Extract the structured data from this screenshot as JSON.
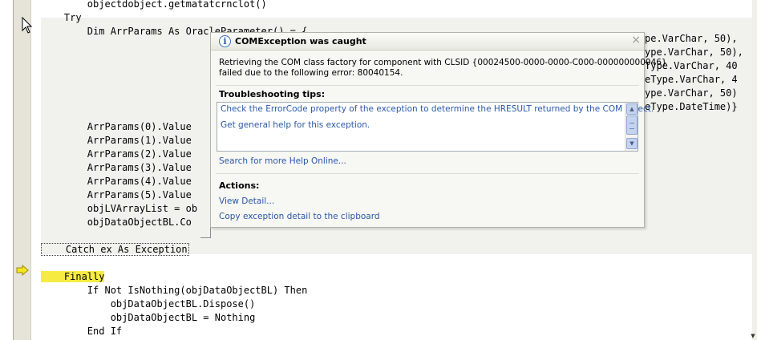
{
  "code": {
    "lines": [
      "        objectdobject.getmatatcrnclot()",
      "    Try",
      "        Dim ArrParams As OracleParameter() = { _",
      "",
      "",
      "",
      "",
      "",
      "",
      "        ArrParams(0).Value",
      "        ArrParams(1).Value",
      "        ArrParams(2).Value",
      "        ArrParams(3).Value",
      "        ArrParams(4).Value",
      "        ArrParams(5).Value",
      "        objLVArrayList = ob",
      "        objDataObjectBL.Co",
      "",
      "    Catch ex As Exception",
      "",
      "    Finally",
      "        If Not IsNothing(objDataObjectBL) Then",
      "            objDataObjectBL.Dispose()",
      "            objDataObjectBL = Nothing",
      "        End If"
    ],
    "right_fragments": [
      "pe.VarChar, 50),",
      "ype.VarChar, 50),",
      "Type.VarChar, 40",
      "eType.VarChar, 4",
      "ype.VarChar, 50)",
      "eType.DateTime)}"
    ]
  },
  "dialog": {
    "title": "COMException was caught",
    "message_line1": "Retrieving the COM class factory for component with CLSID {00024500-0000-0000-C000-000000000046}",
    "message_line2": "failed due to the following error: 80040154.",
    "tips_heading": "Troubleshooting tips:",
    "tips": [
      "Check the ErrorCode property of the exception to determine the HRESULT returned by the COM object.",
      "Get general help for this exception."
    ],
    "search_link": "Search for more Help Online...",
    "actions_heading": "Actions:",
    "actions": [
      "View Detail...",
      "Copy exception detail to the clipboard"
    ],
    "close_glyph": "×"
  }
}
